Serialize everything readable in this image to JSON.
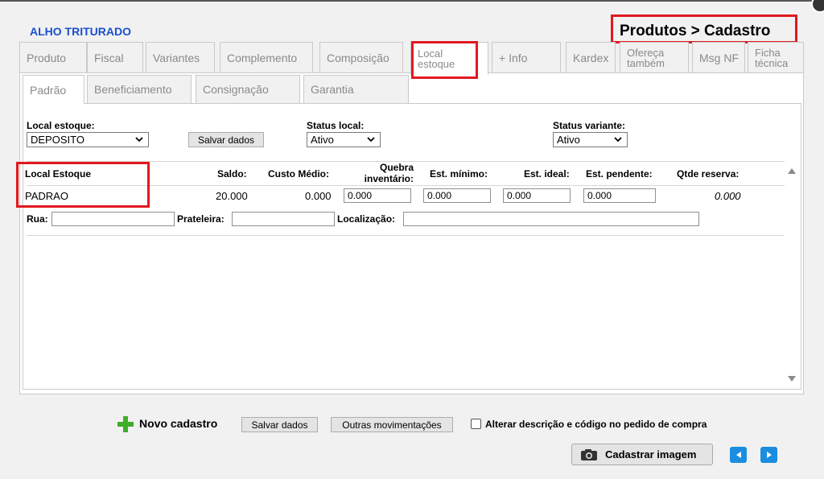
{
  "header": {
    "product_name": "ALHO TRITURADO",
    "breadcrumb": "Produtos > Cadastro"
  },
  "tabs": [
    {
      "label": "Produto"
    },
    {
      "label": "Fiscal"
    },
    {
      "label": "Variantes"
    },
    {
      "label": "Complemento"
    },
    {
      "label": "Composição"
    },
    {
      "label": "Local estoque",
      "line1": "Local",
      "line2": "estoque",
      "active": true
    },
    {
      "label": "+ Info"
    },
    {
      "label": "Kardex"
    },
    {
      "label": "Ofereça também",
      "line1": "Ofereça",
      "line2": "também"
    },
    {
      "label": "Msg NF"
    },
    {
      "label": "Ficha técnica",
      "line1": "Ficha",
      "line2": "técnica"
    }
  ],
  "subtabs": [
    {
      "label": "Padrão",
      "active": true
    },
    {
      "label": "Beneficiamento"
    },
    {
      "label": "Consignação"
    },
    {
      "label": "Garantia"
    }
  ],
  "filters": {
    "local_estoque_label": "Local estoque:",
    "local_estoque_value": "DEPOSITO",
    "save_label": "Salvar dados",
    "status_local_label": "Status local:",
    "status_local_value": "Ativo",
    "status_variante_label": "Status variante:",
    "status_variante_value": "Ativo"
  },
  "table": {
    "headers": {
      "local_estoque": "Local Estoque",
      "saldo": "Saldo:",
      "custo_medio": "Custo Médio:",
      "quebra_line1": "Quebra",
      "quebra_line2": "inventário:",
      "est_minimo": "Est. mínimo:",
      "est_ideal": "Est. ideal:",
      "est_pendente": "Est. pendente:",
      "qtde_reserva": "Qtde reserva:"
    },
    "row": {
      "local": "PADRAO",
      "saldo": "20.000",
      "custo_medio": "0.000",
      "quebra": "0.000",
      "est_minimo": "0.000",
      "est_ideal": "0.000",
      "est_pendente": "0.000",
      "qtde_reserva": "0.000"
    },
    "location": {
      "rua_label": "Rua:",
      "rua_value": "",
      "prateleira_label": "Prateleira:",
      "prateleira_value": "",
      "localizacao_label": "Localização:",
      "localizacao_value": ""
    }
  },
  "footer": {
    "novo_cadastro": "Novo cadastro",
    "salvar_dados": "Salvar dados",
    "outras_movimentacoes": "Outras movimentações",
    "alterar_checkbox_label": "Alterar descrição e código no pedido de compra",
    "alterar_checked": false,
    "cadastrar_imagem": "Cadastrar imagem"
  },
  "icons": {
    "plus": "plus-icon",
    "camera": "camera-icon",
    "prev": "arrow-left-icon",
    "next": "arrow-right-icon"
  },
  "colors": {
    "title_blue": "#1a4fcf",
    "highlight_red": "#e0191f",
    "nav_blue": "#1a8de0",
    "plus_green": "#3fae2a"
  }
}
